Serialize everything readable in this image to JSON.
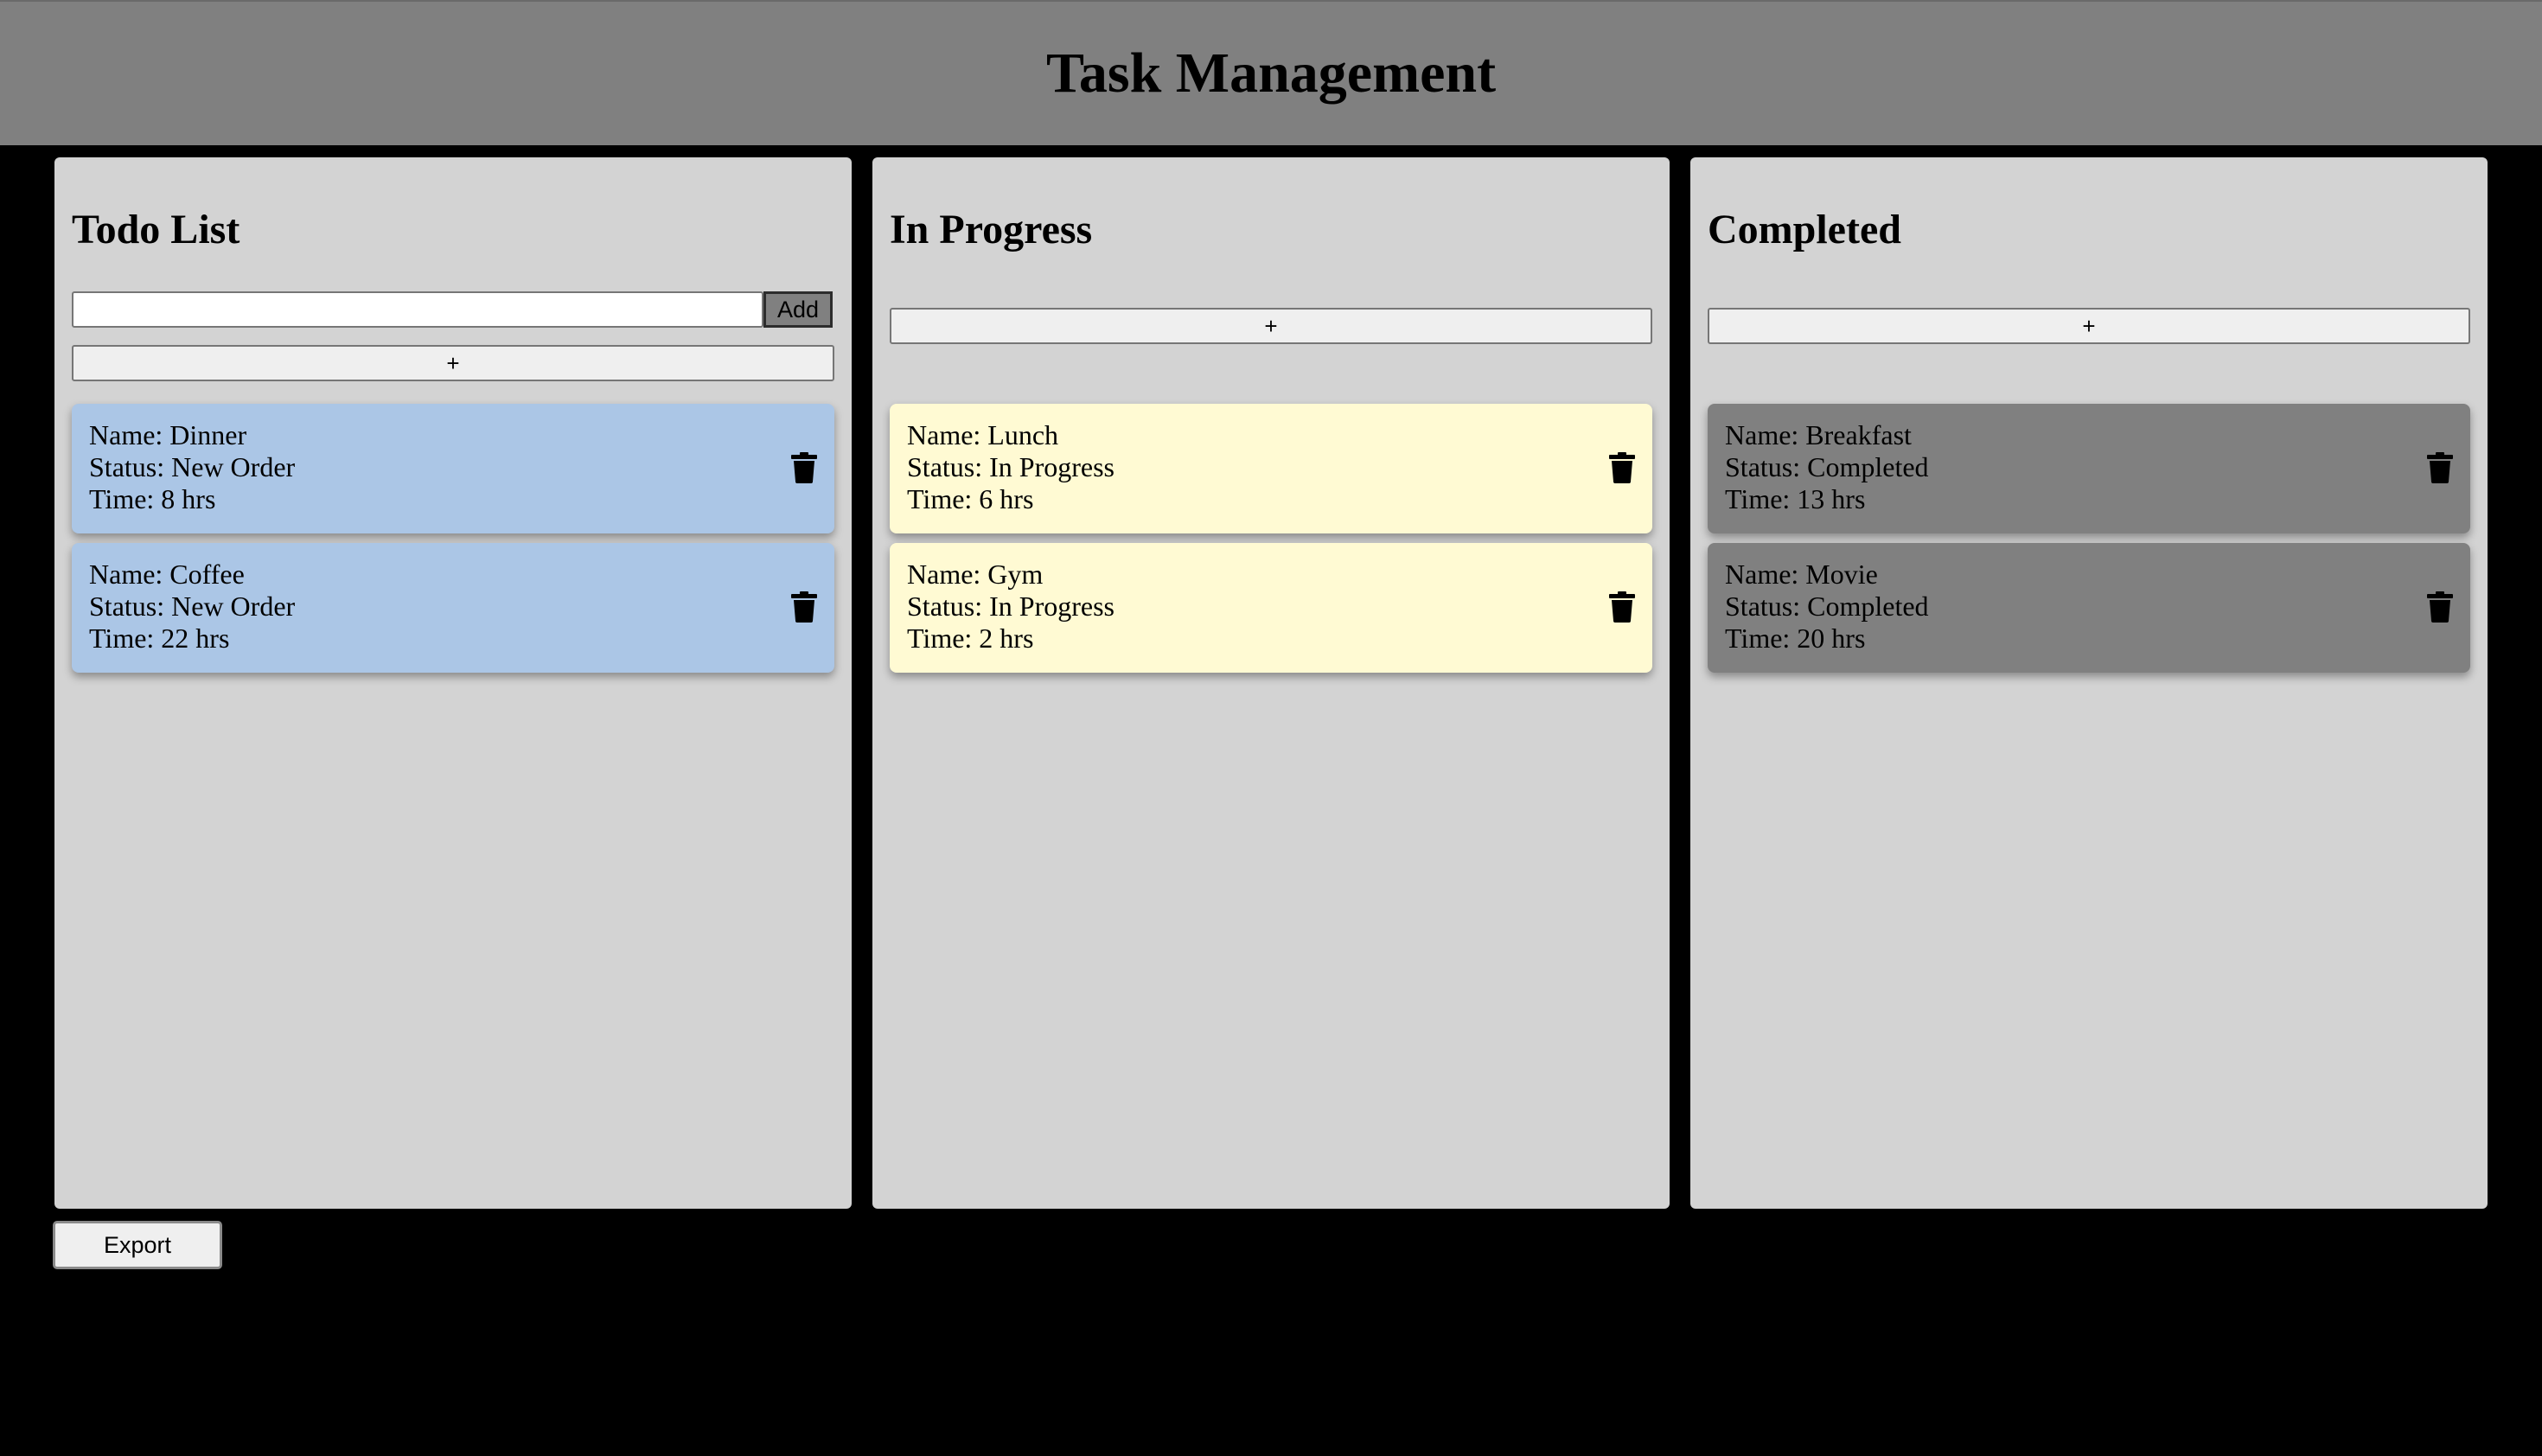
{
  "header": {
    "title": "Task Management"
  },
  "columns": [
    {
      "title": "Todo List",
      "input_value": "",
      "add_label": "Add",
      "plus_label": "+",
      "cards": [
        {
          "name": "Name: Dinner",
          "status": "Status: New Order",
          "time": "Time: 8 hrs"
        },
        {
          "name": "Name: Coffee",
          "status": "Status: New Order",
          "time": "Time: 22 hrs"
        }
      ]
    },
    {
      "title": "In Progress",
      "plus_label": "+",
      "cards": [
        {
          "name": "Name: Lunch",
          "status": "Status: In Progress",
          "time": "Time: 6 hrs"
        },
        {
          "name": "Name: Gym",
          "status": "Status: In Progress",
          "time": "Time: 2 hrs"
        }
      ]
    },
    {
      "title": "Completed",
      "plus_label": "+",
      "cards": [
        {
          "name": "Name: Breakfast",
          "status": "Status: Completed",
          "time": "Time: 13 hrs"
        },
        {
          "name": "Name: Movie",
          "status": "Status: Completed",
          "time": "Time: 20 hrs"
        }
      ]
    }
  ],
  "footer": {
    "export_label": "Export"
  },
  "icons": {
    "delete": "trash-icon"
  },
  "colors": {
    "header_bg": "#808080",
    "column_bg": "#d3d3d3",
    "todo_card": "#abc6e6",
    "progress_card": "#fffad3",
    "completed_card": "#808080",
    "page_bg": "#000000"
  }
}
